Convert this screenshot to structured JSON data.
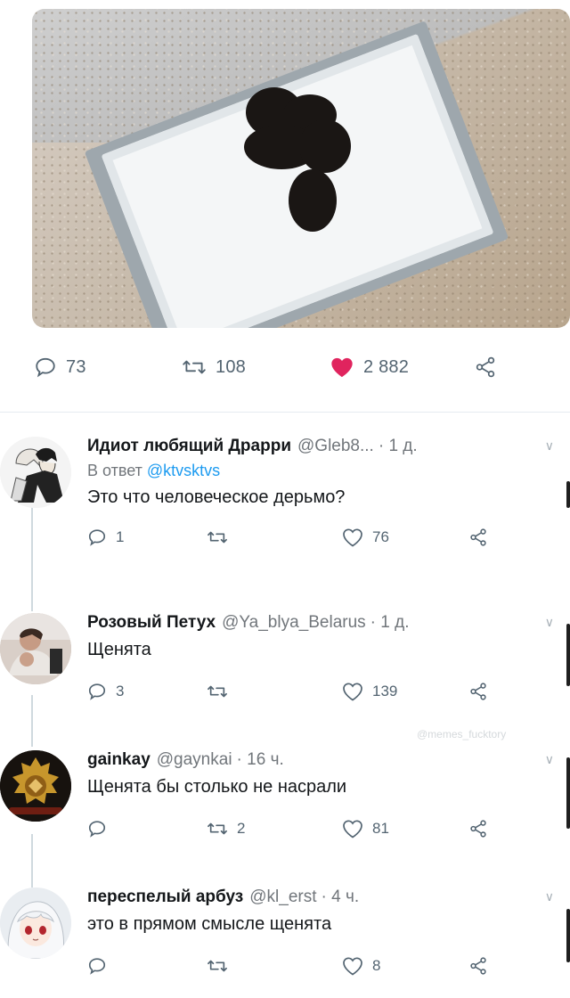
{
  "tweet": {
    "stats": {
      "replies": "73",
      "retweets": "108",
      "likes": "2 882"
    },
    "colors": {
      "like_active": "#e0245e",
      "icon": "#536471",
      "mention": "#1d9bf0"
    }
  },
  "replies": [
    {
      "name": "Идиот любящий Драрри",
      "handle": "@Gleb8...",
      "time": "· 1 д.",
      "reply_to_prefix": "В ответ",
      "reply_to_handle": "@ktvsktvs",
      "text": "Это что человеческое дерьмо?",
      "replies": "1",
      "retweets": "",
      "likes": "76"
    },
    {
      "name": "Розовый Петух",
      "handle": "@Ya_blya_Belarus",
      "time": "· 1 д.",
      "text": "Щенята",
      "replies": "3",
      "retweets": "",
      "likes": "139"
    },
    {
      "name": "gainkay",
      "handle": "@gaynkai",
      "time": "· 16 ч.",
      "text": "Щенята бы столько не насрали",
      "replies": "",
      "retweets": "2",
      "likes": "81"
    },
    {
      "name": "переспелый арбуз",
      "handle": "@kl_erst",
      "time": "· 4 ч.",
      "text": "это в прямом смысле щенята",
      "replies": "",
      "retweets": "",
      "likes": "8"
    }
  ],
  "watermark": "@memes_fucktory",
  "icons": {
    "reply": "speech-bubble-icon",
    "retweet": "retweet-arrows-icon",
    "like": "heart-icon",
    "share": "share-nodes-icon",
    "caret": "chevron-down-icon"
  }
}
